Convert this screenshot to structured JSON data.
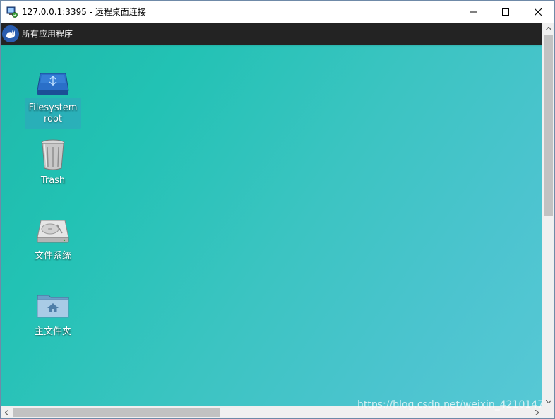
{
  "window": {
    "title": "127.0.0.1:3395 - 远程桌面连接",
    "controls": [
      "minimize",
      "maximize",
      "close"
    ]
  },
  "panel": {
    "menu_label": "所有应用程序",
    "menu_icon": "xfce-mouse-icon"
  },
  "desktop": {
    "icons": [
      {
        "label_line1": "Filesystem",
        "label_line2": "root",
        "icon": "drive-usb-icon",
        "selected": true
      },
      {
        "label": "Trash",
        "icon": "trash-icon"
      },
      {
        "label": "文件系统",
        "icon": "hard-drive-icon"
      },
      {
        "label": "主文件夹",
        "icon": "home-folder-icon"
      }
    ]
  },
  "watermark": "https://blog.csdn.net/weixin_4210147",
  "colors": {
    "panel": "#232323",
    "desktop_start": "#1eb9a9",
    "desktop_end": "#57c8d5"
  }
}
